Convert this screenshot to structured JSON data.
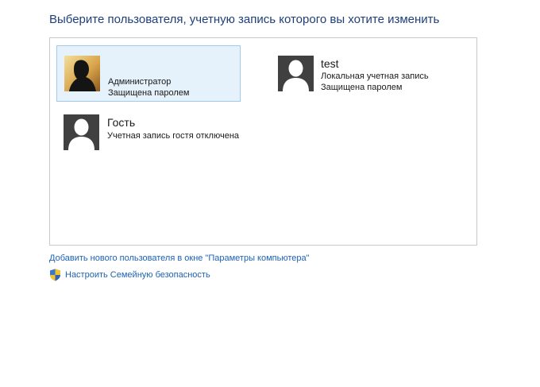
{
  "heading": "Выберите пользователя, учетную запись которого вы хотите изменить",
  "accounts": [
    {
      "name": "Администратор",
      "details": [
        "Защищена паролем"
      ],
      "avatar": "user-photo-icon",
      "selected": true
    },
    {
      "name": "test",
      "details": [
        "Локальная учетная запись",
        "Защищена паролем"
      ],
      "avatar": "default-user-icon",
      "selected": false
    },
    {
      "name": "Гость",
      "details": [
        "Учетная запись гостя отключена"
      ],
      "avatar": "default-user-icon",
      "selected": false
    }
  ],
  "links": {
    "add_user": "Добавить нового пользователя в окне \"Параметры компьютера\"",
    "family_safety": "Настроить Семейную безопасность"
  },
  "colors": {
    "heading": "#1e3f7a",
    "link": "#1b61b6",
    "selection_fill": "#e5f1fb",
    "selection_border": "#9ecbee"
  }
}
